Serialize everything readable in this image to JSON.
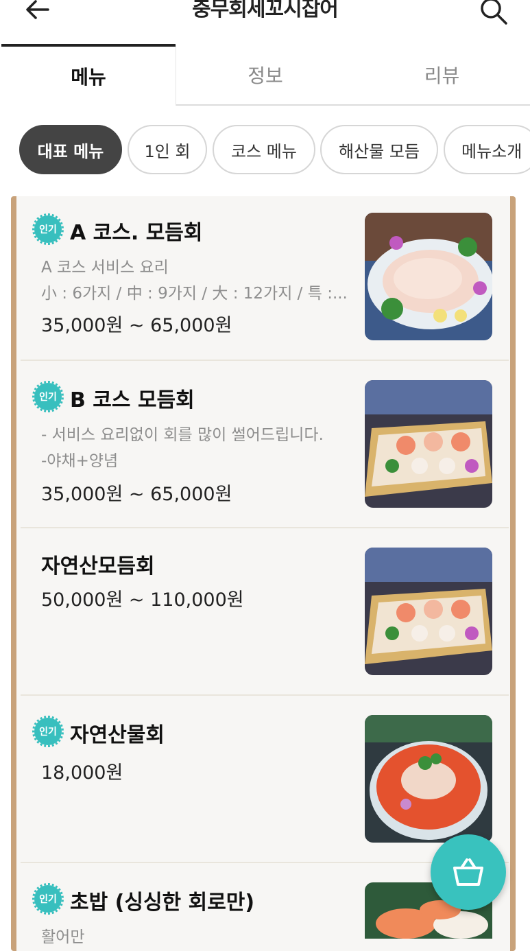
{
  "header": {
    "title": "충무회세꼬시잡어"
  },
  "tabs": [
    {
      "label": "메뉴",
      "active": true
    },
    {
      "label": "정보",
      "active": false
    },
    {
      "label": "리뷰",
      "active": false
    }
  ],
  "categories": [
    {
      "label": "대표 메뉴",
      "active": true
    },
    {
      "label": "1인 회",
      "active": false
    },
    {
      "label": "코스 메뉴",
      "active": false
    },
    {
      "label": "해산물 모듬",
      "active": false
    },
    {
      "label": "메뉴소개",
      "active": false
    }
  ],
  "badge_label": "인기",
  "menu_items": [
    {
      "name": "A 코스. 모듬회",
      "popular": true,
      "desc1": "A 코스 서비스 요리",
      "desc2": "小 : 6가지 / 中 : 9가지 / 大 : 12가지 / 특 :...",
      "price": "35,000원 ~ 65,000원"
    },
    {
      "name": "B 코스 모듬회",
      "popular": true,
      "desc1": "- 서비스 요리없이 회를 많이 썰어드립니다.",
      "desc2": "-야채+양념",
      "price": "35,000원 ~ 65,000원"
    },
    {
      "name": "자연산모듬회",
      "popular": false,
      "price": "50,000원 ~ 110,000원"
    },
    {
      "name": "자연산물회",
      "popular": true,
      "price": "18,000원"
    },
    {
      "name": "초밥 (싱싱한 회로만)",
      "popular": true,
      "desc1": "활어만"
    }
  ],
  "colors": {
    "accent": "#38bfbe",
    "active_chip": "#444444",
    "frame": "#c8a27a"
  },
  "icons": {
    "back": "arrow-left-icon",
    "search": "search-icon",
    "cart": "basket-icon"
  }
}
